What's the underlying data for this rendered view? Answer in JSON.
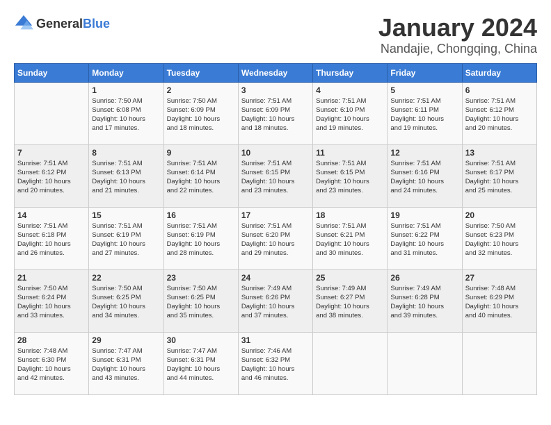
{
  "header": {
    "logo_general": "General",
    "logo_blue": "Blue",
    "month_title": "January 2024",
    "location": "Nandajie, Chongqing, China"
  },
  "days_of_week": [
    "Sunday",
    "Monday",
    "Tuesday",
    "Wednesday",
    "Thursday",
    "Friday",
    "Saturday"
  ],
  "weeks": [
    [
      {
        "day": "",
        "info": ""
      },
      {
        "day": "1",
        "info": "Sunrise: 7:50 AM\nSunset: 6:08 PM\nDaylight: 10 hours\nand 17 minutes."
      },
      {
        "day": "2",
        "info": "Sunrise: 7:50 AM\nSunset: 6:09 PM\nDaylight: 10 hours\nand 18 minutes."
      },
      {
        "day": "3",
        "info": "Sunrise: 7:51 AM\nSunset: 6:09 PM\nDaylight: 10 hours\nand 18 minutes."
      },
      {
        "day": "4",
        "info": "Sunrise: 7:51 AM\nSunset: 6:10 PM\nDaylight: 10 hours\nand 19 minutes."
      },
      {
        "day": "5",
        "info": "Sunrise: 7:51 AM\nSunset: 6:11 PM\nDaylight: 10 hours\nand 19 minutes."
      },
      {
        "day": "6",
        "info": "Sunrise: 7:51 AM\nSunset: 6:12 PM\nDaylight: 10 hours\nand 20 minutes."
      }
    ],
    [
      {
        "day": "7",
        "info": "Sunrise: 7:51 AM\nSunset: 6:12 PM\nDaylight: 10 hours\nand 20 minutes."
      },
      {
        "day": "8",
        "info": "Sunrise: 7:51 AM\nSunset: 6:13 PM\nDaylight: 10 hours\nand 21 minutes."
      },
      {
        "day": "9",
        "info": "Sunrise: 7:51 AM\nSunset: 6:14 PM\nDaylight: 10 hours\nand 22 minutes."
      },
      {
        "day": "10",
        "info": "Sunrise: 7:51 AM\nSunset: 6:15 PM\nDaylight: 10 hours\nand 23 minutes."
      },
      {
        "day": "11",
        "info": "Sunrise: 7:51 AM\nSunset: 6:15 PM\nDaylight: 10 hours\nand 23 minutes."
      },
      {
        "day": "12",
        "info": "Sunrise: 7:51 AM\nSunset: 6:16 PM\nDaylight: 10 hours\nand 24 minutes."
      },
      {
        "day": "13",
        "info": "Sunrise: 7:51 AM\nSunset: 6:17 PM\nDaylight: 10 hours\nand 25 minutes."
      }
    ],
    [
      {
        "day": "14",
        "info": "Sunrise: 7:51 AM\nSunset: 6:18 PM\nDaylight: 10 hours\nand 26 minutes."
      },
      {
        "day": "15",
        "info": "Sunrise: 7:51 AM\nSunset: 6:19 PM\nDaylight: 10 hours\nand 27 minutes."
      },
      {
        "day": "16",
        "info": "Sunrise: 7:51 AM\nSunset: 6:19 PM\nDaylight: 10 hours\nand 28 minutes."
      },
      {
        "day": "17",
        "info": "Sunrise: 7:51 AM\nSunset: 6:20 PM\nDaylight: 10 hours\nand 29 minutes."
      },
      {
        "day": "18",
        "info": "Sunrise: 7:51 AM\nSunset: 6:21 PM\nDaylight: 10 hours\nand 30 minutes."
      },
      {
        "day": "19",
        "info": "Sunrise: 7:51 AM\nSunset: 6:22 PM\nDaylight: 10 hours\nand 31 minutes."
      },
      {
        "day": "20",
        "info": "Sunrise: 7:50 AM\nSunset: 6:23 PM\nDaylight: 10 hours\nand 32 minutes."
      }
    ],
    [
      {
        "day": "21",
        "info": "Sunrise: 7:50 AM\nSunset: 6:24 PM\nDaylight: 10 hours\nand 33 minutes."
      },
      {
        "day": "22",
        "info": "Sunrise: 7:50 AM\nSunset: 6:25 PM\nDaylight: 10 hours\nand 34 minutes."
      },
      {
        "day": "23",
        "info": "Sunrise: 7:50 AM\nSunset: 6:25 PM\nDaylight: 10 hours\nand 35 minutes."
      },
      {
        "day": "24",
        "info": "Sunrise: 7:49 AM\nSunset: 6:26 PM\nDaylight: 10 hours\nand 37 minutes."
      },
      {
        "day": "25",
        "info": "Sunrise: 7:49 AM\nSunset: 6:27 PM\nDaylight: 10 hours\nand 38 minutes."
      },
      {
        "day": "26",
        "info": "Sunrise: 7:49 AM\nSunset: 6:28 PM\nDaylight: 10 hours\nand 39 minutes."
      },
      {
        "day": "27",
        "info": "Sunrise: 7:48 AM\nSunset: 6:29 PM\nDaylight: 10 hours\nand 40 minutes."
      }
    ],
    [
      {
        "day": "28",
        "info": "Sunrise: 7:48 AM\nSunset: 6:30 PM\nDaylight: 10 hours\nand 42 minutes."
      },
      {
        "day": "29",
        "info": "Sunrise: 7:47 AM\nSunset: 6:31 PM\nDaylight: 10 hours\nand 43 minutes."
      },
      {
        "day": "30",
        "info": "Sunrise: 7:47 AM\nSunset: 6:31 PM\nDaylight: 10 hours\nand 44 minutes."
      },
      {
        "day": "31",
        "info": "Sunrise: 7:46 AM\nSunset: 6:32 PM\nDaylight: 10 hours\nand 46 minutes."
      },
      {
        "day": "",
        "info": ""
      },
      {
        "day": "",
        "info": ""
      },
      {
        "day": "",
        "info": ""
      }
    ]
  ]
}
